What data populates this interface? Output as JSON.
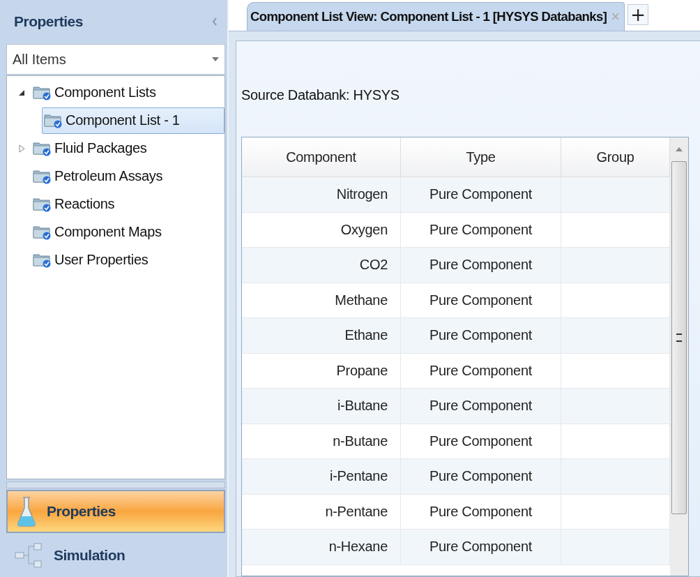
{
  "sidebar": {
    "title": "Properties",
    "filter": {
      "value": "All Items"
    },
    "tree": [
      {
        "label": "Component Lists",
        "expanded": true,
        "selected": false,
        "children": [
          {
            "label": "Component List - 1",
            "selected": true
          }
        ]
      },
      {
        "label": "Fluid Packages",
        "expanded": false,
        "selected": false
      },
      {
        "label": "Petroleum Assays",
        "selected": false
      },
      {
        "label": "Reactions",
        "selected": false
      },
      {
        "label": "Component Maps",
        "selected": false
      },
      {
        "label": "User Properties",
        "selected": false
      }
    ],
    "nav": [
      {
        "label": "Properties",
        "kind": "flask",
        "selected": true
      },
      {
        "label": "Simulation",
        "kind": "flowsheet",
        "selected": false
      }
    ]
  },
  "tabs": [
    {
      "label": "Component List View: Component List - 1 [HYSYS Databanks]",
      "selected": true,
      "close": "×"
    }
  ],
  "new_tab": "+",
  "source_databank": "Source Databank: HYSYS",
  "table": {
    "columns": [
      "Component",
      "Type",
      "Group"
    ],
    "rows": [
      [
        "Nitrogen",
        "Pure Component"
      ],
      [
        "Oxygen",
        "Pure Component"
      ],
      [
        "CO2",
        "Pure Component"
      ],
      [
        "Methane",
        "Pure Component"
      ],
      [
        "Ethane",
        "Pure Component"
      ],
      [
        "Propane",
        "Pure Component"
      ],
      [
        "i-Butane",
        "Pure Component"
      ],
      [
        "n-Butane",
        "Pure Component"
      ],
      [
        "i-Pentane",
        "Pure Component"
      ],
      [
        "n-Pentane",
        "Pure Component"
      ],
      [
        "n-Hexane",
        "Pure Component"
      ]
    ]
  }
}
